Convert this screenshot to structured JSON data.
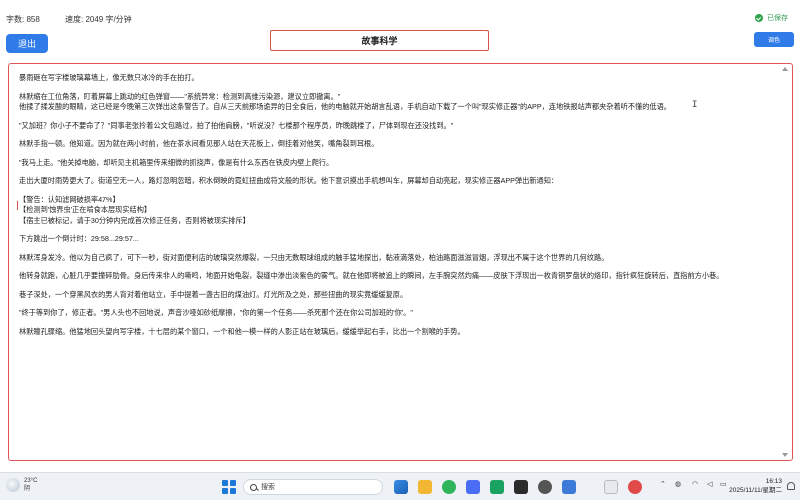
{
  "status": {
    "word_count": "字数: 858",
    "speed": "速度: 2049 字/分钟",
    "saved": "已保存"
  },
  "header": {
    "back_label": "退出",
    "title": "故事科学",
    "color_label": "调色"
  },
  "editor": {
    "paragraphs": [
      "暴雨砸在写字楼玻璃幕墙上，像无数只冰冷的手在拍打。",
      "林默缩在工位角落，盯着屏幕上跳动的红色弹窗——\"系统异常：检测到高维污染源，建议立即撤离。\"\n他揉了揉发酸的眼睛，这已经是今晚第三次弹出这条警告了。自从三天前那场诡异的日全食后，他的电脑就开始胡言乱语，手机自动下载了一个叫\"现实修正器\"的APP，连地铁报站声都夹杂着听不懂的低语。",
      "\"又加班？你小子不要命了？\"同事老张拎着公文包路过，拍了拍他肩膀，\"听说没？七楼那个程序员，昨晚跳楼了，尸体到现在还没找到。\"",
      "林默手指一顿。他知道。因为就在两小时前，他在茶水间看见那人站在天花板上，倒挂着对他笑，嘴角裂到耳根。",
      "\"我马上走。\"他关掉电脑，却听见主机箱里传来细微的抓挠声，像是有什么东西在铁皮内壁上爬行。",
      "走出大厦时雨势更大了。街道空无一人，路灯忽明忽暗，积水倒映的霓虹扭曲成符文般的形状。他下意识摸出手机想叫车，屏幕却自动亮起，现实修正器APP弹出新通知：",
      "【警告：认知滤网破损率47%】\n【检测到'蚀界虫'正在啃食本层现实结构】\n【宿主已被标记，请于30分钟内完成首次修正任务，否则将被现实排斥】",
      "下方跳出一个倒计时：29:58...29:57...",
      "林默浑身发冷。他以为自己疯了，可下一秒，街对面便利店的玻璃突然爆裂，一只由无数眼球组成的触手猛地探出，黏液滴落处，柏油路面滋滋冒烟，浮现出不属于这个世界的几何纹路。",
      "他转身就跑，心脏几乎要撞碎肋骨。身后传来非人的嘶鸣，地面开始龟裂，裂缝中渗出淡紫色的雾气。就在他即将被追上的瞬间，左手腕突然灼痛——皮肤下浮现出一枚青铜罗盘状的烙印，指针疯狂旋转后，直指前方小巷。",
      "巷子深处，一个穿黑风衣的男人背对着他站立，手中提着一盏古旧的煤油灯。灯光所及之处，那些扭曲的现实竟缓缓复原。",
      "\"终于等到你了，修正者。\"男人头也不回地说，声音沙哑如砂纸摩擦，\"你的第一个任务——杀死那个还在你公司加班的'你'。\"",
      "林默瞳孔骤缩。他猛地回头望向写字楼，十七层的某个窗口，一个和他一模一样的人影正站在玻璃后，缓缓举起右手，比出一个割喉的手势。"
    ]
  },
  "taskbar": {
    "temperature": "23°C",
    "weather": "阴",
    "search_placeholder": "搜索",
    "time": "16:13",
    "date": "2025/11/11/星期二"
  }
}
